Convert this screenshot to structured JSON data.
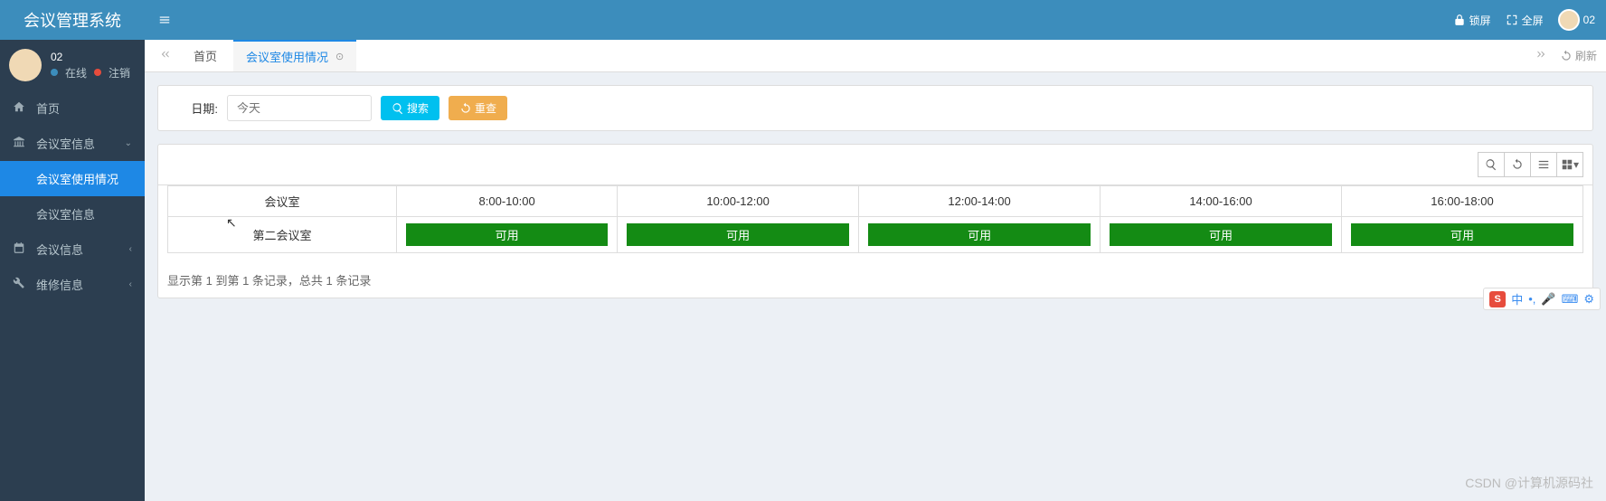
{
  "header": {
    "title": "会议管理系统",
    "lock": "锁屏",
    "fullscreen": "全屏",
    "username": "02"
  },
  "sidebar": {
    "user": {
      "name": "02",
      "online": "在线",
      "logout": "注销"
    },
    "items": [
      {
        "label": "首页",
        "icon": "home"
      },
      {
        "label": "会议室信息",
        "icon": "bank",
        "expandable": true,
        "expanded": true
      },
      {
        "label": "会议室使用情况",
        "sub": true,
        "active": true
      },
      {
        "label": "会议室信息",
        "sub": true
      },
      {
        "label": "会议信息",
        "icon": "calendar",
        "expandable": true
      },
      {
        "label": "维修信息",
        "icon": "wrench",
        "expandable": true
      }
    ]
  },
  "tabs": {
    "home": "首页",
    "current": "会议室使用情况",
    "refresh": "刷新"
  },
  "search": {
    "date_label": "日期:",
    "date_placeholder": "今天",
    "search_btn": "搜索",
    "reset_btn": "重查"
  },
  "table": {
    "headers": [
      "会议室",
      "8:00-10:00",
      "10:00-12:00",
      "12:00-14:00",
      "14:00-16:00",
      "16:00-18:00"
    ],
    "rows": [
      {
        "room": "第二会议室",
        "slots": [
          "可用",
          "可用",
          "可用",
          "可用",
          "可用"
        ]
      }
    ],
    "summary": "显示第 1 到第 1 条记录，总共 1 条记录"
  },
  "ime": {
    "logo": "S",
    "lang": "中"
  },
  "watermark": "CSDN @计算机源码社"
}
